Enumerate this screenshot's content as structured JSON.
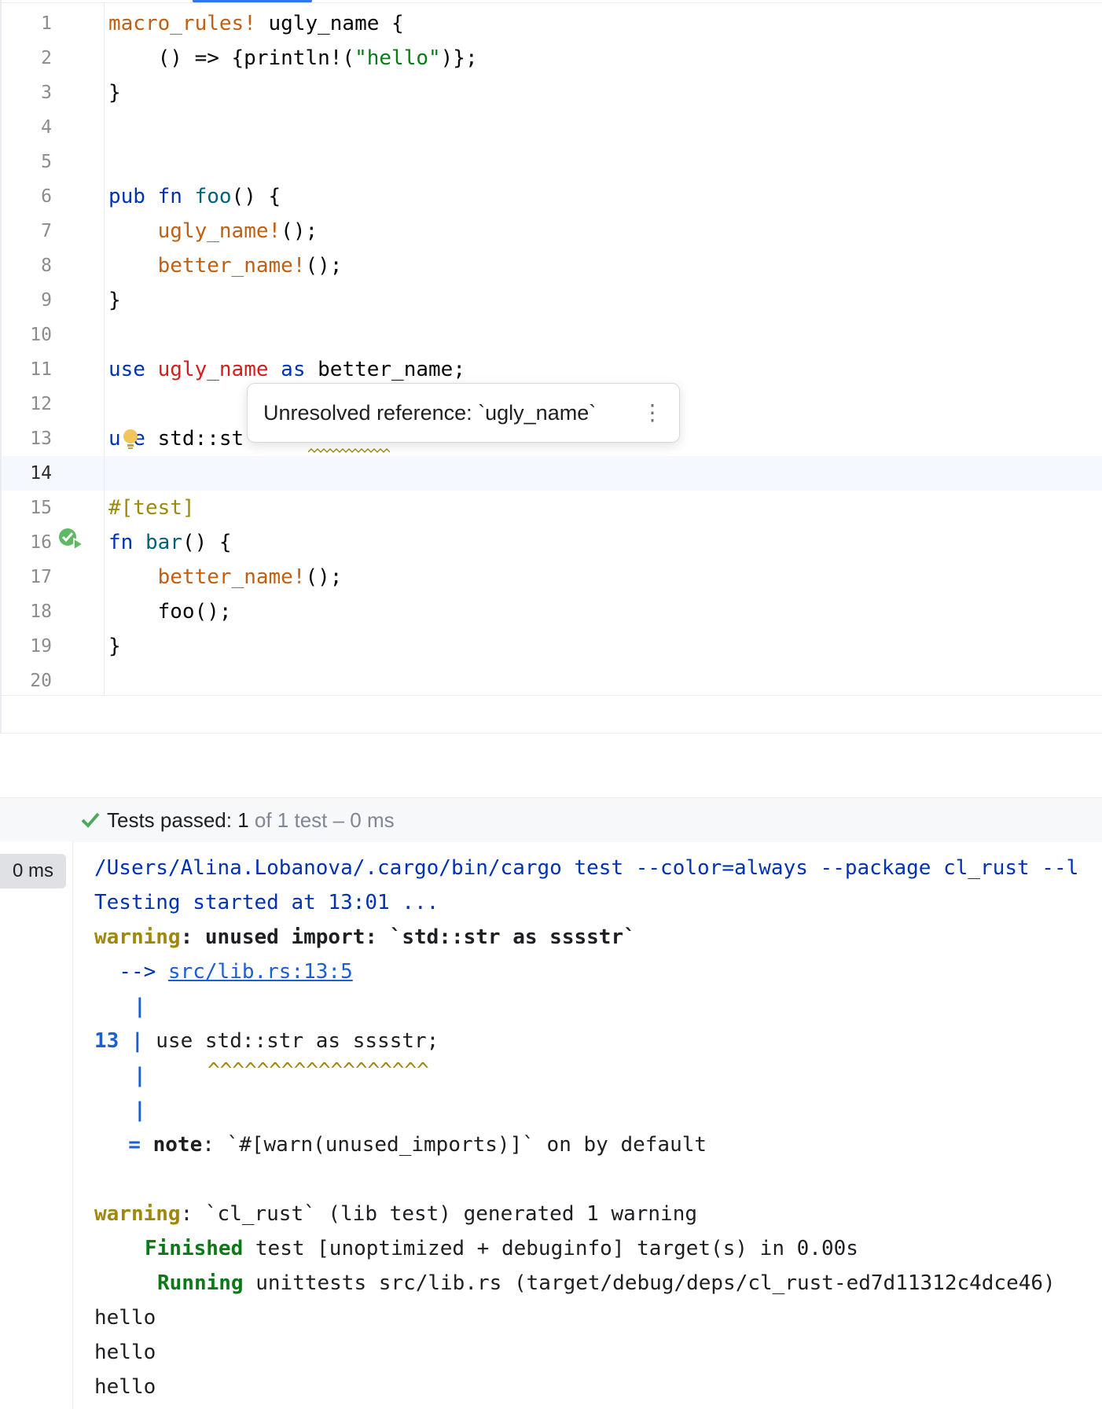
{
  "editor": {
    "lines": [
      {
        "n": "1",
        "parts": [
          [
            "mac",
            "macro_rules!"
          ],
          [
            "p",
            " ugly_name {"
          ]
        ]
      },
      {
        "n": "2",
        "parts": [
          [
            "p",
            "    () => {println!("
          ],
          [
            "str",
            "\"hello\""
          ],
          [
            "p",
            ")};"
          ]
        ]
      },
      {
        "n": "3",
        "parts": [
          [
            "p",
            "}"
          ]
        ]
      },
      {
        "n": "4",
        "parts": []
      },
      {
        "n": "5",
        "parts": []
      },
      {
        "n": "6",
        "parts": [
          [
            "kw",
            "pub fn "
          ],
          [
            "fn",
            "foo"
          ],
          [
            "p",
            "() {"
          ]
        ]
      },
      {
        "n": "7",
        "parts": [
          [
            "p",
            "    "
          ],
          [
            "mac",
            "ugly_name!"
          ],
          [
            "p",
            "();"
          ]
        ]
      },
      {
        "n": "8",
        "parts": [
          [
            "p",
            "    "
          ],
          [
            "mac",
            "better_name!"
          ],
          [
            "p",
            "();"
          ]
        ]
      },
      {
        "n": "9",
        "parts": [
          [
            "p",
            "}"
          ]
        ]
      },
      {
        "n": "10",
        "parts": []
      },
      {
        "n": "11",
        "parts": [
          [
            "kw",
            "use "
          ],
          [
            "err",
            "ugly_name"
          ],
          [
            "kw",
            " as "
          ],
          [
            "p",
            "better_name;"
          ]
        ]
      },
      {
        "n": "12",
        "parts": []
      },
      {
        "n": "13",
        "parts": [
          [
            "kw",
            "u e"
          ],
          [
            "p",
            " std::st"
          ]
        ]
      },
      {
        "n": "14",
        "parts": []
      },
      {
        "n": "15",
        "parts": [
          [
            "attr",
            "#[test]"
          ]
        ]
      },
      {
        "n": "16",
        "parts": [
          [
            "kw",
            "fn "
          ],
          [
            "fn",
            "bar"
          ],
          [
            "p",
            "() {"
          ]
        ]
      },
      {
        "n": "17",
        "parts": [
          [
            "p",
            "    "
          ],
          [
            "mac",
            "better_name!"
          ],
          [
            "p",
            "();"
          ]
        ]
      },
      {
        "n": "18",
        "parts": [
          [
            "p",
            "    foo();"
          ]
        ]
      },
      {
        "n": "19",
        "parts": [
          [
            "p",
            "}"
          ]
        ]
      },
      {
        "n": "20",
        "parts": []
      }
    ],
    "active_line": "14",
    "tooltip_text": "Unresolved reference: `ugly_name`",
    "tooltip_more": "⋮"
  },
  "tests": {
    "status_main": "Tests passed: 1",
    "status_rest": " of 1 test – 0 ms",
    "tree_time": "0 ms"
  },
  "console": {
    "cmd": "/Users/Alina.Lobanova/.cargo/bin/cargo test --color=always --package cl_rust --l",
    "started": "Testing started at 13:01 ...",
    "warn_label": "warning",
    "warn_msg": ": unused import: `std::str as sssstr`",
    "arrow": "  --> ",
    "location": "src/lib.rs:13:5",
    "pipe": "|",
    "src_num": "13",
    "src_code": " use std::str as sssstr;",
    "carets": "^^^^^^^^^^^^^^^^^^",
    "note_eq": "  = ",
    "note_label": "note",
    "note_msg": ": `#[warn(unused_imports)]` on by default",
    "warn2_msg": ": `cl_rust` (lib test) generated 1 warning",
    "finished_label": "Finished",
    "finished_msg": " test [unoptimized + debuginfo] target(s) in 0.00s",
    "running_label": "Running",
    "running_msg": " unittests src/lib.rs (target/debug/deps/cl_rust-ed7d11312c4dce46)",
    "output": [
      "hello",
      "hello",
      "hello"
    ]
  }
}
